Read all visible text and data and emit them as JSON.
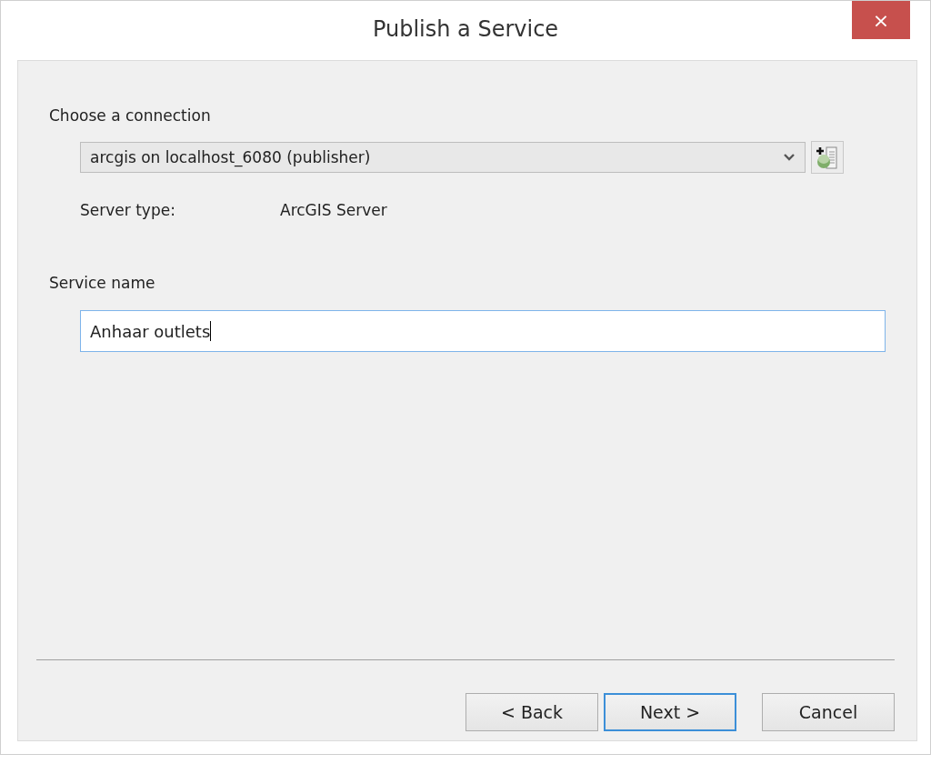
{
  "window": {
    "title": "Publish a Service",
    "close": "×"
  },
  "connection": {
    "label": "Choose a connection",
    "value": "arcgis on localhost_6080 (publisher)",
    "server_type_label": "Server type:",
    "server_type": "ArcGIS Server"
  },
  "service": {
    "label": "Service name",
    "value": "Anhaar outlets"
  },
  "buttons": [
    {
      "label": "< Back",
      "default": false
    },
    {
      "label": "Next >",
      "default": true
    },
    {
      "label": "Cancel",
      "default": false
    }
  ]
}
